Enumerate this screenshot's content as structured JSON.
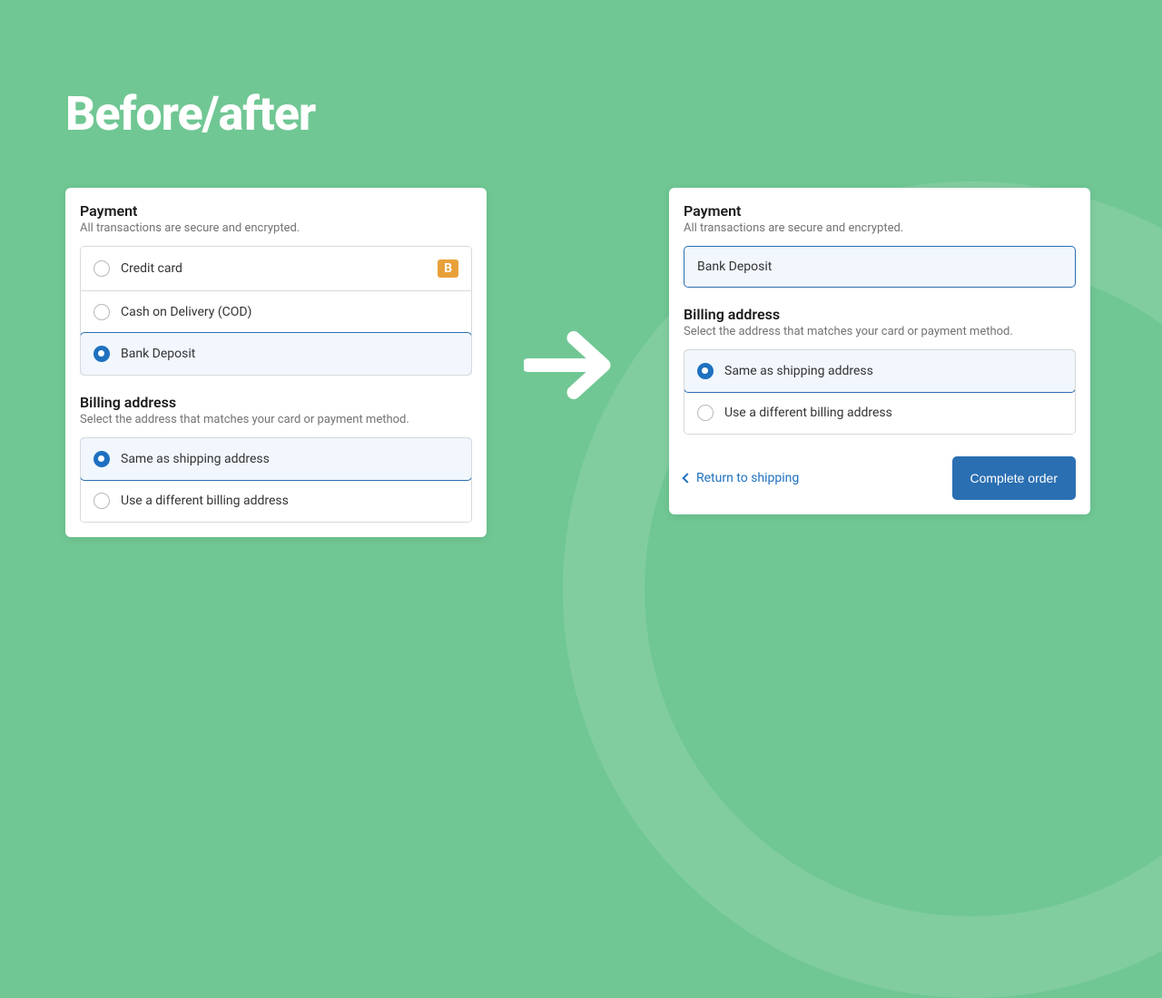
{
  "title": "Before/after",
  "before": {
    "payment": {
      "title": "Payment",
      "subtitle": "All transactions are secure and encrypted.",
      "options": [
        {
          "label": "Credit card",
          "badge": "B"
        },
        {
          "label": "Cash on Delivery (COD)"
        },
        {
          "label": "Bank Deposit",
          "selected": true
        }
      ]
    },
    "billing": {
      "title": "Billing address",
      "subtitle": "Select the address that matches your card or payment method.",
      "options": [
        {
          "label": "Same as shipping address",
          "selected": true
        },
        {
          "label": "Use a different billing address"
        }
      ]
    }
  },
  "after": {
    "payment": {
      "title": "Payment",
      "subtitle": "All transactions are secure and encrypted.",
      "single": "Bank Deposit"
    },
    "billing": {
      "title": "Billing address",
      "subtitle": "Select the address that matches your card or payment method.",
      "options": [
        {
          "label": "Same as shipping address",
          "selected": true
        },
        {
          "label": "Use a different billing address"
        }
      ]
    },
    "footer": {
      "back_label": "Return to shipping",
      "cta_label": "Complete order"
    }
  }
}
